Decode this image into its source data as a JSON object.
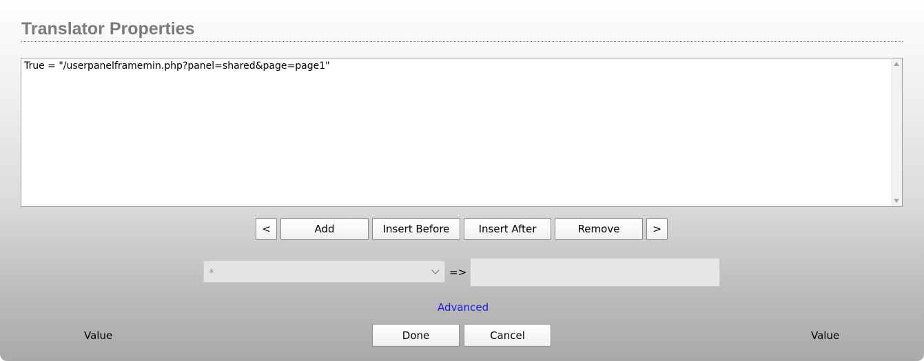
{
  "dialog": {
    "title": "Translator Properties"
  },
  "list": {
    "items": [
      "True = \"/userpanelframemin.php?panel=shared&page=page1\""
    ]
  },
  "toolbar": {
    "prev_label": "<",
    "add_label": "Add",
    "insert_before_label": "Insert Before",
    "insert_after_label": "Insert After",
    "remove_label": "Remove",
    "next_label": ">"
  },
  "mapping": {
    "select_value": "*",
    "arrow_label": "=>",
    "value_input": ""
  },
  "advanced_link": "Advanced",
  "footer": {
    "left_label": "Value",
    "done_label": "Done",
    "cancel_label": "Cancel",
    "right_label": "Value"
  },
  "colors": {
    "title": "#7b7b7b",
    "link": "#1a1ad6"
  }
}
